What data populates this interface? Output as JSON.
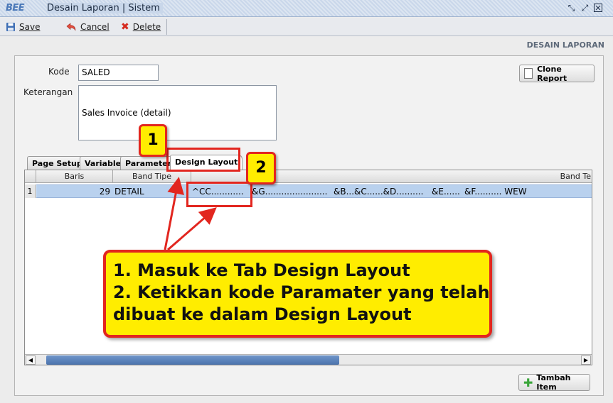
{
  "window": {
    "logo": "BEE",
    "title": "Desain Laporan | Sistem",
    "controls": [
      "restore-icon",
      "maximize-icon",
      "close-icon"
    ]
  },
  "toolbar": {
    "save_label": "Save",
    "cancel_label": "Cancel",
    "delete_label": "Delete"
  },
  "panel": {
    "header": "DESAIN LAPORAN"
  },
  "form": {
    "kode_label": "Kode",
    "kode_value": "SALED",
    "keterangan_label": "Keterangan",
    "keterangan_value": "Sales Invoice (detail)",
    "clone_label": "Clone Report"
  },
  "tabs": [
    {
      "label": "Page Setup",
      "active": false
    },
    {
      "label": "Variable",
      "active": false
    },
    {
      "label": "Parameter",
      "active": false
    },
    {
      "label": "Design Layout",
      "active": true
    }
  ],
  "grid": {
    "columns": [
      "Baris",
      "Band Tipe",
      "Band Te"
    ],
    "rows": [
      {
        "num": "1",
        "baris": "29",
        "band_tipe": "DETAIL",
        "parts": [
          "^CC............",
          "&G.......................",
          "&B...&C......&D..........",
          "&E......",
          "&F.......... WEW"
        ]
      }
    ]
  },
  "add_item_label": "Tambah Item",
  "annotations": {
    "badge1": "1",
    "badge2": "2",
    "lines": [
      "1. Masuk ke Tab Design Layout",
      "2. Ketikkan kode Paramater yang telah",
      "dibuat ke dalam Design Layout"
    ],
    "color_red": "#e2261f",
    "color_yellow": "#ffed00"
  },
  "colors": {
    "titlebar": "#c9d7ea",
    "selected_row": "#b9d1ee",
    "scroll_thumb": "#4b73ad"
  }
}
